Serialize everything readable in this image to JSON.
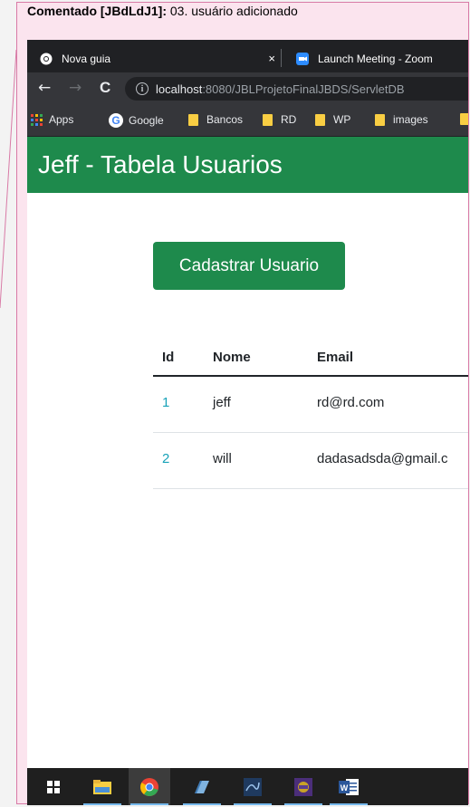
{
  "comment": {
    "label": "Comentado [JBdLdJ1]:",
    "text": " 03. usuário adicionado"
  },
  "browser": {
    "tabs": [
      {
        "title": "Nova guia",
        "icon": "chrome-favicon"
      },
      {
        "title": "Launch Meeting - Zoom",
        "icon": "zoom-favicon"
      }
    ],
    "tab_close": "×",
    "nav": {
      "back": "←",
      "forward": "→",
      "reload": "C"
    },
    "url_host": "localhost",
    "url_rest": ":8080/JBLProjetoFinalJBDS/ServletDB",
    "info_icon": "i",
    "bookmarks": [
      "Apps",
      "Google",
      "Bancos",
      "RD",
      "WP",
      "images"
    ]
  },
  "page": {
    "title": "Jeff - Tabela Usuarios",
    "button_label": "Cadastrar Usuario",
    "table": {
      "headers": [
        "Id",
        "Nome",
        "Email"
      ],
      "rows": [
        {
          "id": "1",
          "nome": "jeff",
          "email": "rd@rd.com"
        },
        {
          "id": "2",
          "nome": "will",
          "email": "dadasadsda@gmail.c"
        }
      ]
    }
  },
  "taskbar": {
    "items": [
      "windows-start-icon",
      "file-explorer-icon",
      "chrome-icon",
      "app-icon",
      "app-icon",
      "app-icon",
      "word-icon"
    ]
  },
  "colors": {
    "header_green": "#1e8a4c",
    "link_teal": "#17a2b8",
    "comment_pink": "#fbe4ee"
  }
}
